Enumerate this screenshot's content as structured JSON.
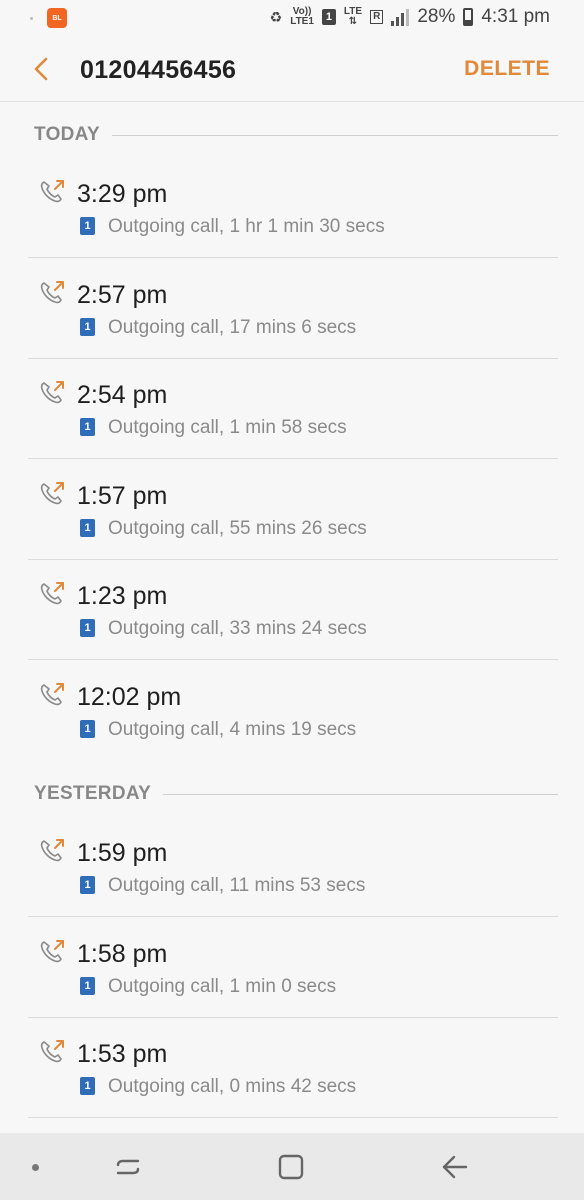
{
  "status_bar": {
    "notification_app": "BL",
    "volte_top": "Vo))",
    "volte_bottom": "LTE1",
    "sim_slot": "1",
    "network": "LTE",
    "roaming": "R",
    "battery": "28%",
    "time": "4:31 pm"
  },
  "header": {
    "title": "01204456456",
    "delete_label": "DELETE",
    "accent": "#e0893a"
  },
  "sections": [
    {
      "label": "TODAY",
      "calls": [
        {
          "time": "3:29 pm",
          "sim": "1",
          "detail": "Outgoing call, 1 hr 1 min 30 secs"
        },
        {
          "time": "2:57 pm",
          "sim": "1",
          "detail": "Outgoing call, 17 mins 6 secs"
        },
        {
          "time": "2:54 pm",
          "sim": "1",
          "detail": "Outgoing call, 1 min 58 secs"
        },
        {
          "time": "1:57 pm",
          "sim": "1",
          "detail": "Outgoing call, 55 mins 26 secs"
        },
        {
          "time": "1:23 pm",
          "sim": "1",
          "detail": "Outgoing call, 33 mins 24 secs"
        },
        {
          "time": "12:02 pm",
          "sim": "1",
          "detail": "Outgoing call, 4 mins 19 secs"
        }
      ]
    },
    {
      "label": "YESTERDAY",
      "calls": [
        {
          "time": "1:59 pm",
          "sim": "1",
          "detail": "Outgoing call, 11 mins 53 secs"
        },
        {
          "time": "1:58 pm",
          "sim": "1",
          "detail": "Outgoing call, 1 min 0 secs"
        },
        {
          "time": "1:53 pm",
          "sim": "1",
          "detail": "Outgoing call, 0 mins 42 secs"
        }
      ]
    }
  ],
  "icons": {
    "back": "chevron-left-icon",
    "outgoing_call": "outgoing-call-icon",
    "nav_recents": "recents-icon",
    "nav_home": "home-icon",
    "nav_back": "back-arrow-icon"
  }
}
